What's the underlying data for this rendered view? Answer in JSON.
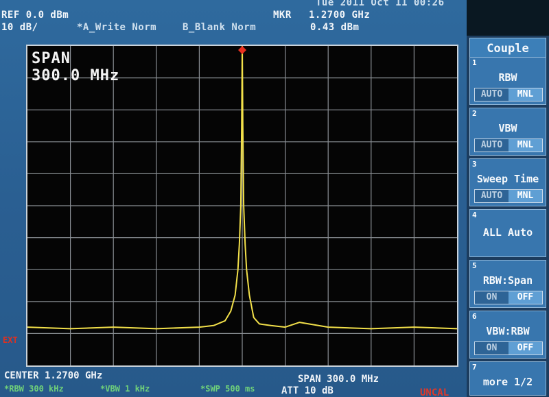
{
  "header": {
    "datetime": "Tue 2011 Oct 11 00:26",
    "ref_level": "REF 0.0 dBm",
    "scale": "10 dB/",
    "trace_a": "*A_Write Norm",
    "trace_b": "B_Blank Norm",
    "marker_label": "MKR",
    "marker_freq": "1.2700 GHz",
    "marker_level": "0.43 dBm"
  },
  "display": {
    "span_label": "SPAN",
    "span_value": "300.0 MHz",
    "ext_label": "EXT",
    "trace_color": "#f2e04a",
    "marker_color": "#e83020"
  },
  "footer": {
    "center": "CENTER 1.2700 GHz",
    "span": "SPAN 300.0 MHz",
    "rbw": "*RBW 300 kHz",
    "vbw": "*VBW 1 kHz",
    "sweep": "*SWP 500 ms",
    "att": "ATT 10 dB",
    "uncal": "UNCAL"
  },
  "softkeys": {
    "title": "Couple",
    "keys": [
      {
        "num": "1",
        "label": "RBW",
        "left": "AUTO",
        "right": "MNL"
      },
      {
        "num": "2",
        "label": "VBW",
        "left": "AUTO",
        "right": "MNL"
      },
      {
        "num": "3",
        "label": "Sweep Time",
        "left": "AUTO",
        "right": "MNL"
      },
      {
        "num": "4",
        "label": "ALL Auto"
      },
      {
        "num": "5",
        "label": "RBW:Span",
        "left": "ON",
        "right": "OFF"
      },
      {
        "num": "6",
        "label": "VBW:RBW",
        "left": "ON",
        "right": "OFF"
      },
      {
        "num": "7",
        "label": "more 1/2"
      }
    ]
  },
  "chart_data": {
    "type": "line",
    "title": "",
    "xlabel": "",
    "ylabel": "",
    "x_unit": "MHz",
    "y_unit": "dBm",
    "xlim": [
      1120.0,
      1420.0
    ],
    "ylim": [
      -100,
      0
    ],
    "grid": true,
    "series": [
      {
        "x": [
          1120,
          1150,
          1180,
          1210,
          1240,
          1250,
          1258,
          1262,
          1265,
          1267,
          1268,
          1269,
          1269.6,
          1270,
          1270.4,
          1271,
          1272,
          1273,
          1275,
          1278,
          1282,
          1290,
          1300,
          1310,
          1330,
          1360,
          1390,
          1420
        ],
        "y": [
          -88,
          -88.5,
          -88,
          -88.5,
          -88,
          -87.5,
          -86,
          -83,
          -78,
          -70,
          -62,
          -50,
          -25,
          0.43,
          -25,
          -50,
          -62,
          -70,
          -78,
          -85,
          -87,
          -87.5,
          -88,
          -86.5,
          -88,
          -88.5,
          -88,
          -88.5
        ]
      }
    ],
    "marker": {
      "x": 1270,
      "y": 0.43
    }
  }
}
